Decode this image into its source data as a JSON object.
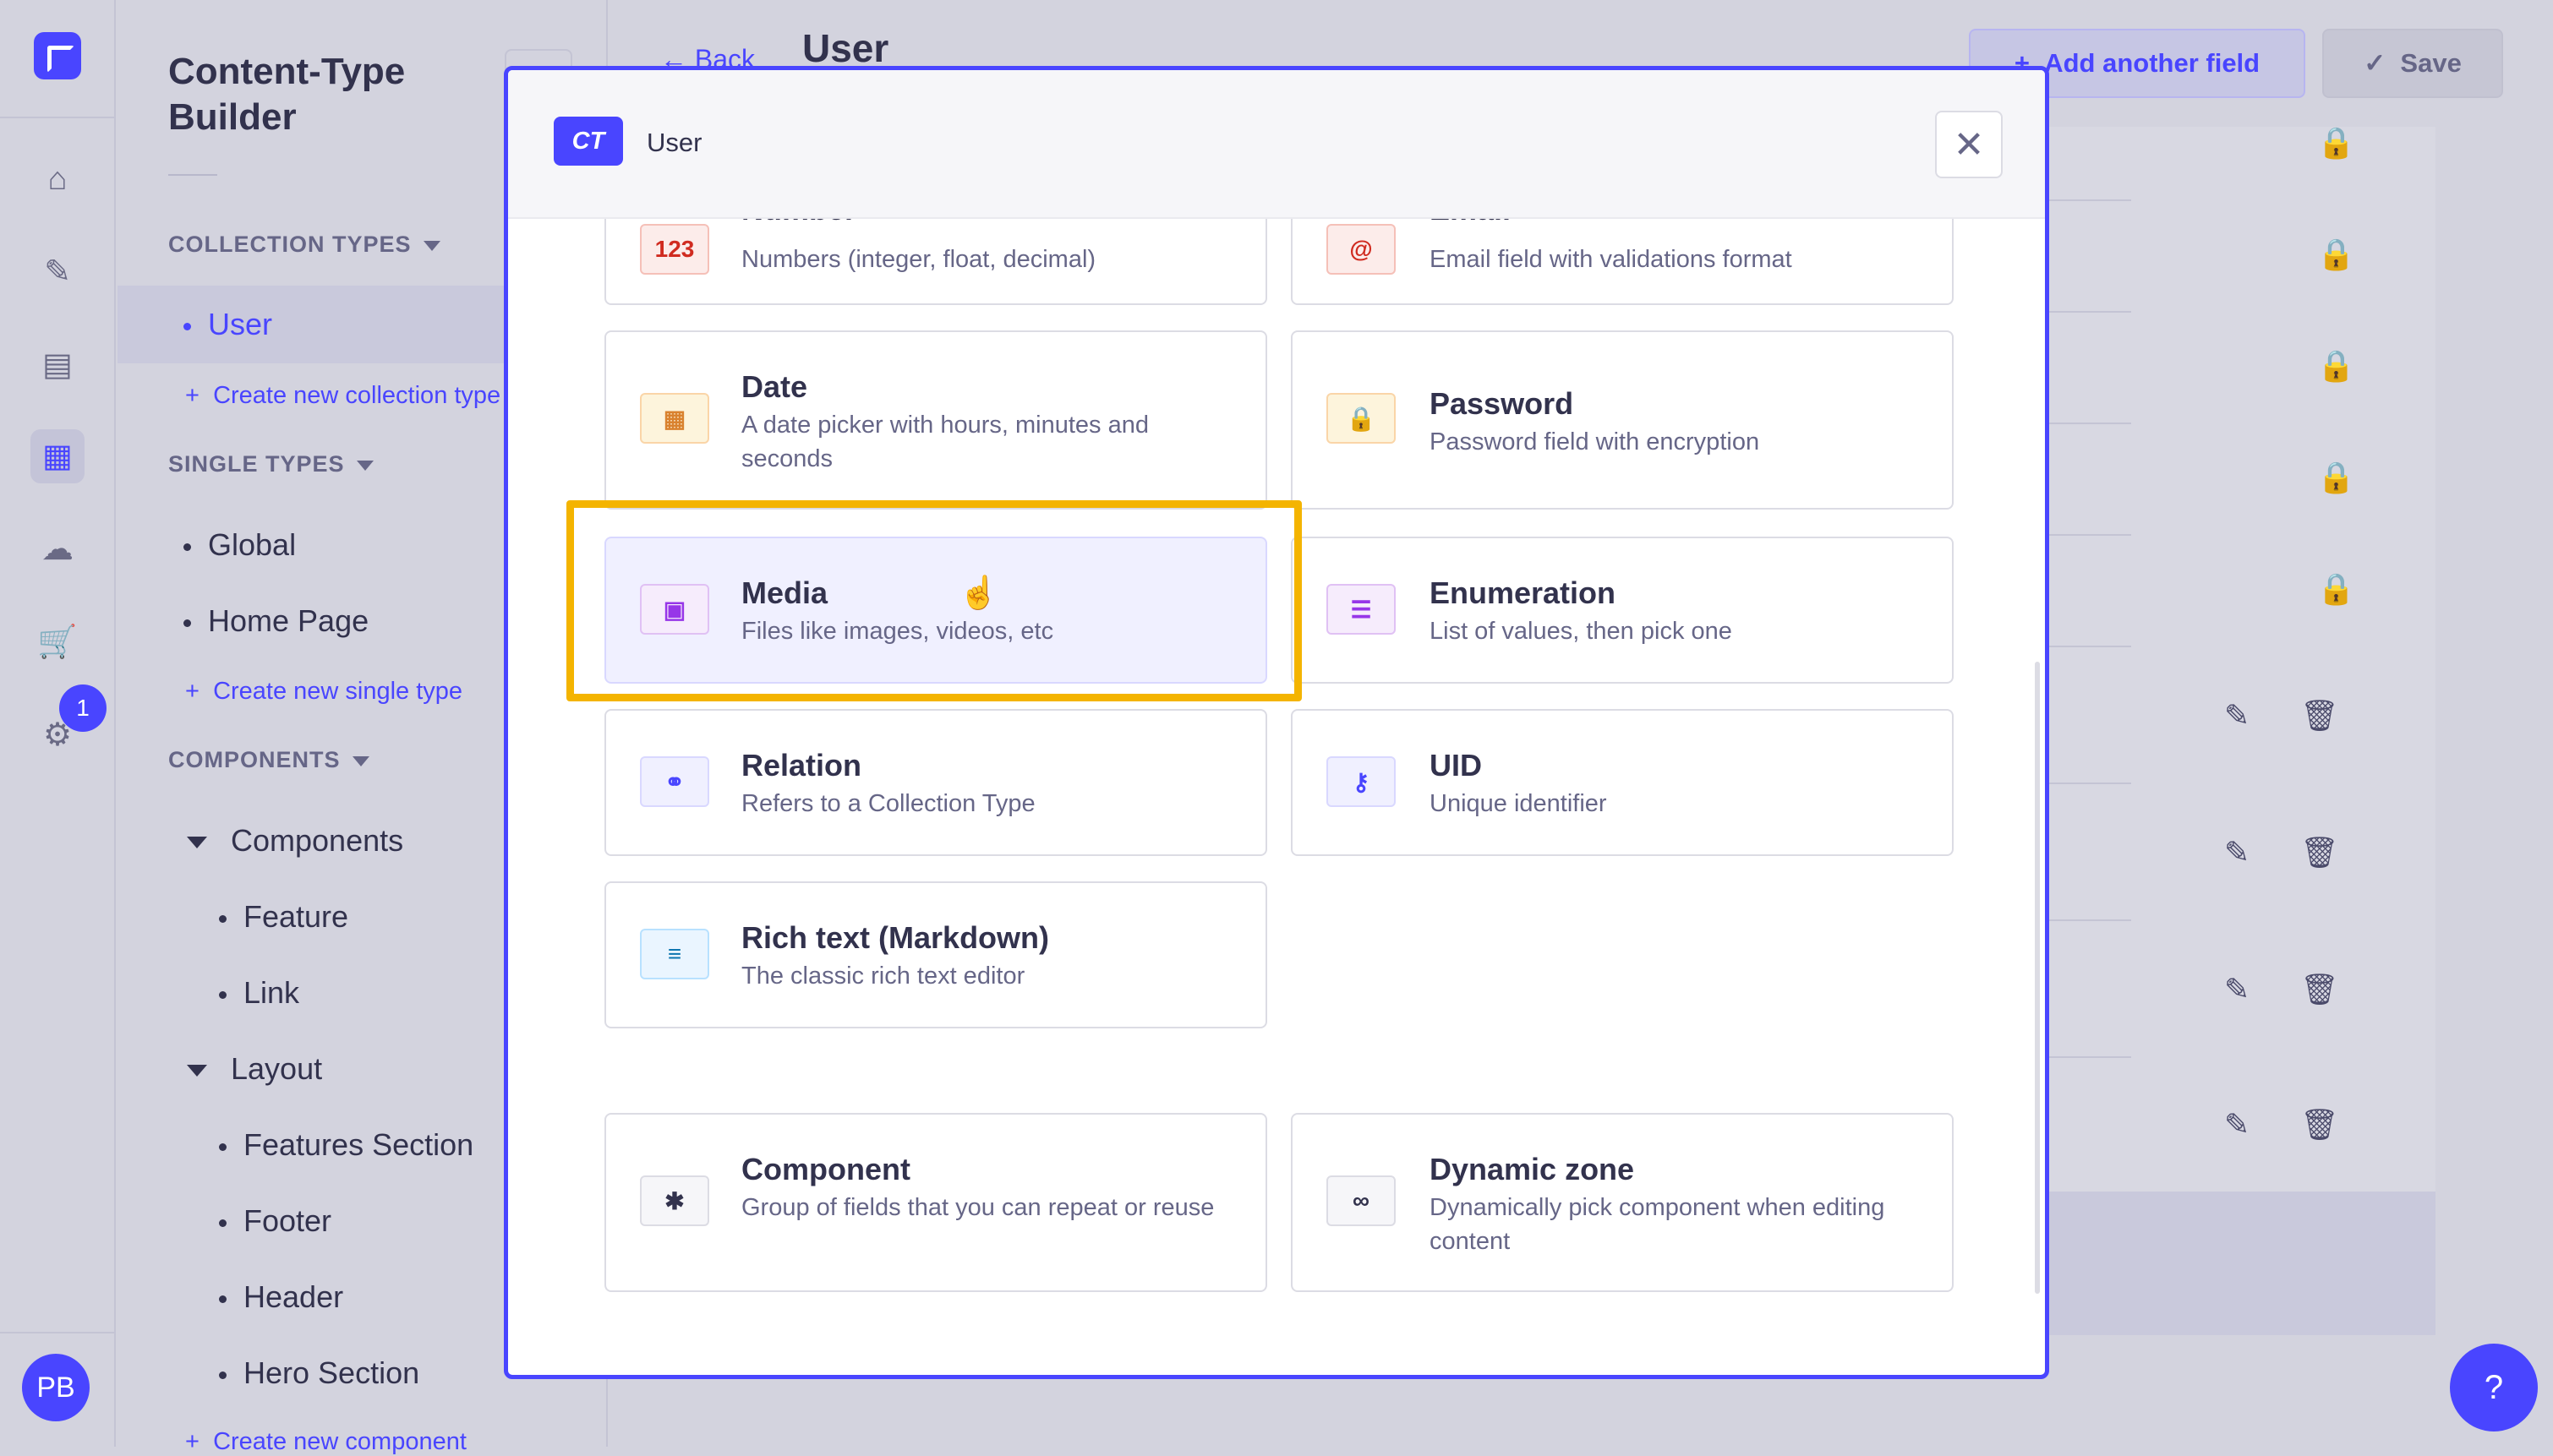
{
  "rail": {
    "icons": [
      "logo-icon",
      "home-icon",
      "feather-icon",
      "media-library-icon",
      "content-type-builder-icon",
      "cloud-icon",
      "cart-icon",
      "settings-icon"
    ],
    "badge": "1",
    "avatar": "PB"
  },
  "sidebar": {
    "title": "Content-Type Builder",
    "collection_types": {
      "heading": "COLLECTION TYPES",
      "items": [
        "User"
      ],
      "create": "Create new collection type"
    },
    "single_types": {
      "heading": "SINGLE TYPES",
      "items": [
        "Global",
        "Home Page"
      ],
      "create": "Create new single type"
    },
    "components": {
      "heading": "COMPONENTS",
      "groups": [
        {
          "name": "Components",
          "items": [
            "Feature",
            "Link"
          ]
        },
        {
          "name": "Layout",
          "items": [
            "Features Section",
            "Footer",
            "Header",
            "Hero Section"
          ]
        }
      ],
      "create": "Create new component"
    }
  },
  "header": {
    "back": "Back",
    "title": "User",
    "add_field": "Add another field",
    "save": "Save"
  },
  "modal": {
    "badge": "CT",
    "title": "User",
    "fields": [
      {
        "title": "Number",
        "desc": "Numbers (integer, float, decimal)",
        "icon": "number-icon",
        "glyph": "123",
        "color": "#d02b20"
      },
      {
        "title": "Email",
        "desc": "Email field with validations format",
        "icon": "email-icon",
        "glyph": "@",
        "color": "#d02b20"
      },
      {
        "title": "Date",
        "desc": "A date picker with hours, minutes and seconds",
        "icon": "calendar-icon",
        "glyph": "▦",
        "color": "#d9822f"
      },
      {
        "title": "Password",
        "desc": "Password field with encryption",
        "icon": "lock-icon",
        "glyph": "🔒",
        "color": "#d9822f"
      },
      {
        "title": "Media",
        "desc": "Files like images, videos, etc",
        "icon": "image-icon",
        "glyph": "▣",
        "color": "#9736e8"
      },
      {
        "title": "Enumeration",
        "desc": "List of values, then pick one",
        "icon": "list-icon",
        "glyph": "☰",
        "color": "#9736e8"
      },
      {
        "title": "Relation",
        "desc": "Refers to a Collection Type",
        "icon": "link-icon",
        "glyph": "⚭",
        "color": "#4945ff"
      },
      {
        "title": "UID",
        "desc": "Unique identifier",
        "icon": "key-icon",
        "glyph": "⚷",
        "color": "#4945ff"
      },
      {
        "title": "Rich text (Markdown)",
        "desc": "The classic rich text editor",
        "icon": "text-align-icon",
        "glyph": "≡",
        "color": "#0c75af"
      }
    ],
    "custom": [
      {
        "title": "Component",
        "desc": "Group of fields that you can repeat or reuse",
        "icon": "component-icon",
        "glyph": "✱",
        "color": "#32324d"
      },
      {
        "title": "Dynamic zone",
        "desc": "Dynamically pick component when editing content",
        "icon": "infinity-icon",
        "glyph": "∞",
        "color": "#32324d"
      }
    ]
  }
}
